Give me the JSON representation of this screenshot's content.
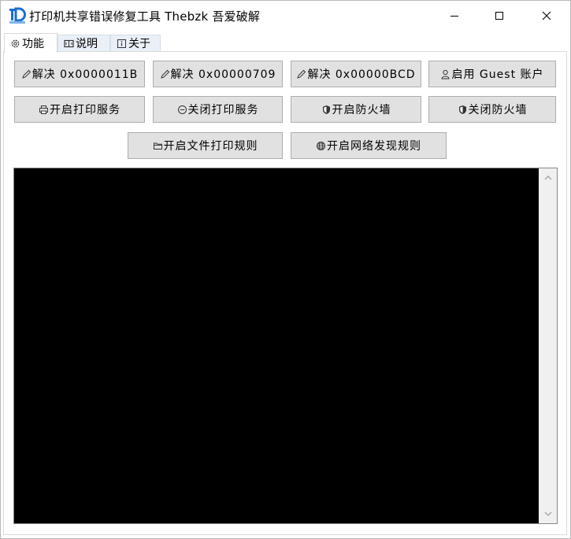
{
  "window": {
    "title": "打印机共享错误修复工具    Thebzk 吾爱破解",
    "icon": "app-logo-icon"
  },
  "tabs": [
    {
      "label": "功能",
      "icon": "gear-icon",
      "active": true
    },
    {
      "label": "说明",
      "icon": "book-icon",
      "active": false
    },
    {
      "label": "关于",
      "icon": "info-icon",
      "active": false
    }
  ],
  "buttons": {
    "row1": [
      {
        "label": "解决 0x0000011B",
        "icon": "pencil-icon"
      },
      {
        "label": "解决 0x00000709",
        "icon": "pencil-icon"
      },
      {
        "label": "解决 0x00000BCD",
        "icon": "pencil-icon"
      },
      {
        "label": "启用 Guest 账户",
        "icon": "user-icon"
      }
    ],
    "row2": [
      {
        "label": "开启打印服务",
        "icon": "printer-icon"
      },
      {
        "label": "关闭打印服务",
        "icon": "minus-circle-icon"
      },
      {
        "label": "开启防火墙",
        "icon": "shield-icon"
      },
      {
        "label": "关闭防火墙",
        "icon": "shield-icon"
      }
    ],
    "row3": [
      {
        "label": "开启文件打印规则",
        "icon": "folder-icon"
      },
      {
        "label": "开启网络发现规则",
        "icon": "globe-icon"
      }
    ]
  },
  "console": {
    "background": "#000000"
  },
  "colors": {
    "button_bg": "#e1e1e1",
    "tab_inactive_bg": "#e9f0f8",
    "logo_blue": "#1a6fd6"
  }
}
